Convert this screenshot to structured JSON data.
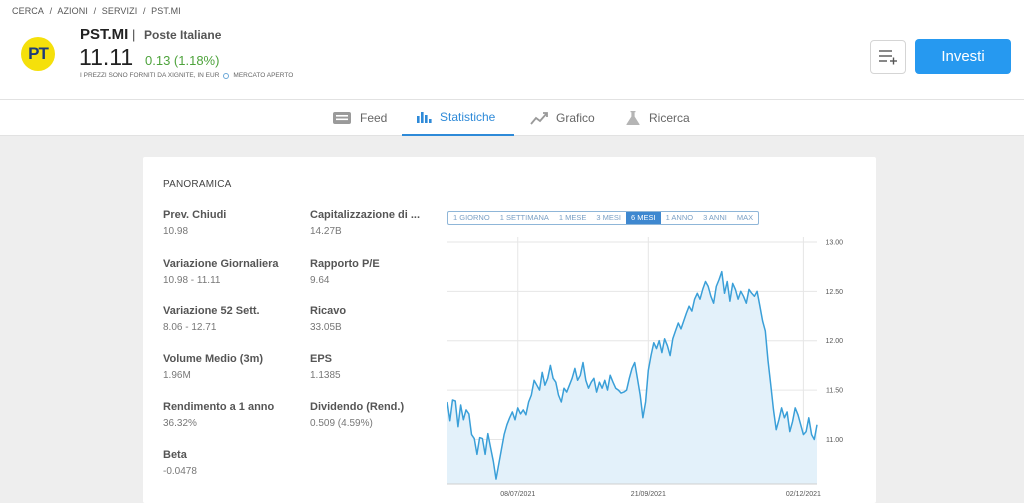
{
  "breadcrumb": [
    "CERCA",
    "AZIONI",
    "SERVIZI",
    "PST.MI"
  ],
  "breadcrumb_sep": "/",
  "stock": {
    "ticker": "PST.MI",
    "separator": "|",
    "company": "Poste Italiane",
    "logo_text": "PT",
    "price": "11.11",
    "change": "0.13 (1.18%)",
    "note": "I PREZZI SONO FORNITI DA XIGNITE, IN EUR",
    "market_status": "MERCATO APERTO"
  },
  "actions": {
    "invest_label": "Investi",
    "watchlist_icon": "add-to-list-icon"
  },
  "tabs": [
    {
      "label": "Feed",
      "icon": "feed-icon",
      "active": false
    },
    {
      "label": "Statistiche",
      "icon": "bar-chart-icon",
      "active": true
    },
    {
      "label": "Grafico",
      "icon": "line-chart-icon",
      "active": false
    },
    {
      "label": "Ricerca",
      "icon": "flask-icon",
      "active": false
    }
  ],
  "overview": {
    "title": "PANORAMICA",
    "stats_left": [
      {
        "label": "Prev. Chiudi",
        "value": "10.98"
      },
      {
        "label": "Variazione Giornaliera",
        "value": "10.98 - 11.11"
      },
      {
        "label": "Variazione 52 Sett.",
        "value": "8.06 - 12.71"
      },
      {
        "label": "Volume Medio (3m)",
        "value": "1.96M"
      },
      {
        "label": "Rendimento a 1 anno",
        "value": "36.32%"
      },
      {
        "label": "Beta",
        "value": "-0.0478"
      }
    ],
    "stats_right": [
      {
        "label": "Capitalizzazione di ...",
        "value": "14.27B"
      },
      {
        "label": "Rapporto P/E",
        "value": "9.64"
      },
      {
        "label": "Ricavo",
        "value": "33.05B"
      },
      {
        "label": "EPS",
        "value": "1.1385"
      },
      {
        "label": "Dividendo (Rend.)",
        "value": "0.509 (4.59%)"
      }
    ]
  },
  "ranges": [
    {
      "label": "1 GIORNO",
      "active": false
    },
    {
      "label": "1 SETTIMANA",
      "active": false
    },
    {
      "label": "1 MESE",
      "active": false
    },
    {
      "label": "3 MESI",
      "active": false
    },
    {
      "label": "6 MESI",
      "active": true
    },
    {
      "label": "1 ANNO",
      "active": false
    },
    {
      "label": "3 ANNI",
      "active": false
    },
    {
      "label": "MAX",
      "active": false
    }
  ],
  "colors": {
    "accent": "#2699f0",
    "positive": "#4ea33c",
    "line": "#3a9fd8",
    "area": "#e3f1fa",
    "logo": "#f5e00b"
  },
  "chart_data": {
    "type": "area",
    "title": "",
    "xlabel": "",
    "ylabel": "",
    "ylim": [
      10.55,
      13.05
    ],
    "y_ticks": [
      "13.00",
      "12.50",
      "12.00",
      "11.50",
      "11.00"
    ],
    "x_ticks": [
      "08/07/2021",
      "21/09/2021",
      "02/12/2021"
    ],
    "grid": true,
    "series": [
      {
        "values": [
          11.38,
          11.19,
          11.4,
          11.39,
          11.13,
          11.35,
          11.2,
          11.3,
          11.26,
          11.05,
          11.01,
          10.85,
          11.02,
          11.01,
          10.85,
          11.06,
          10.92,
          10.78,
          10.6,
          10.75,
          10.9,
          11.05,
          11.15,
          11.22,
          11.28,
          11.2,
          11.32,
          11.26,
          11.3,
          11.25,
          11.38,
          11.45,
          11.6,
          11.55,
          11.5,
          11.68,
          11.55,
          11.62,
          11.75,
          11.62,
          11.58,
          11.45,
          11.38,
          11.52,
          11.48,
          11.55,
          11.62,
          11.72,
          11.6,
          11.65,
          11.78,
          11.6,
          11.52,
          11.58,
          11.62,
          11.48,
          11.58,
          11.52,
          11.6,
          11.5,
          11.65,
          11.58,
          11.52,
          11.5,
          11.47,
          11.48,
          11.5,
          11.62,
          11.72,
          11.78,
          11.62,
          11.45,
          11.22,
          11.38,
          11.7,
          11.85,
          11.98,
          11.92,
          12.0,
          11.88,
          12.02,
          11.95,
          11.85,
          12.02,
          12.1,
          12.18,
          12.12,
          12.2,
          12.28,
          12.35,
          12.3,
          12.42,
          12.48,
          12.42,
          12.52,
          12.6,
          12.55,
          12.45,
          12.38,
          12.55,
          12.62,
          12.7,
          12.48,
          12.6,
          12.4,
          12.58,
          12.52,
          12.42,
          12.5,
          12.45,
          12.38,
          12.52,
          12.48,
          12.45,
          12.5,
          12.35,
          12.2,
          12.1,
          11.8,
          11.55,
          11.3,
          11.1,
          11.2,
          11.32,
          11.22,
          11.28,
          11.08,
          11.18,
          11.32,
          11.25,
          11.15,
          11.05,
          11.08,
          11.22,
          11.05,
          11.0,
          11.15
        ],
        "x_tick_indices": [
          26,
          74,
          131
        ]
      }
    ]
  }
}
